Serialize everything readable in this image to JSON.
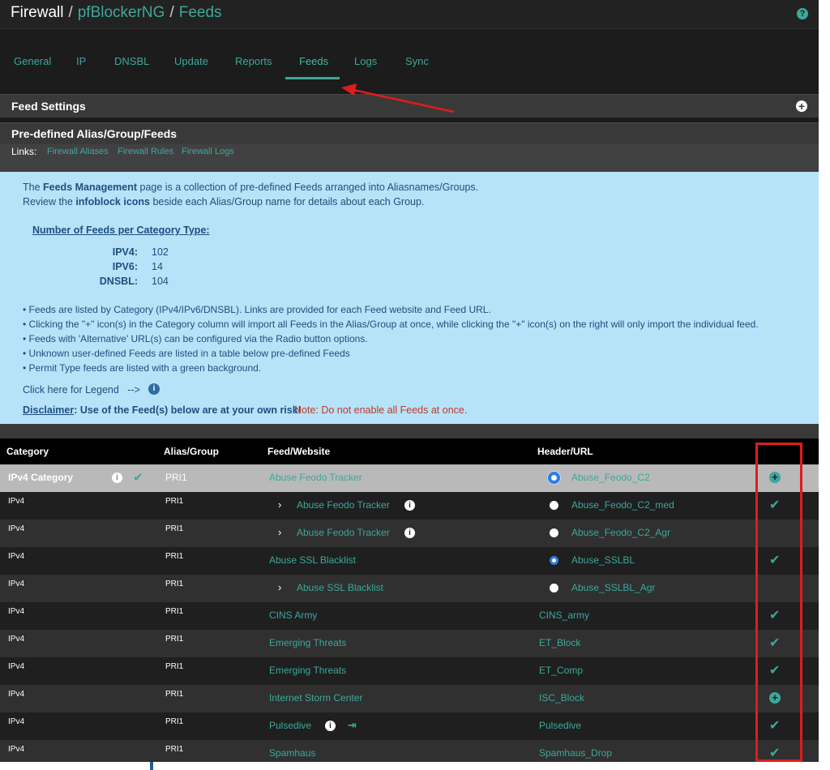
{
  "breadcrumb": {
    "root": "Firewall",
    "sep": "/",
    "items": [
      "pfBlockerNG",
      "Feeds"
    ]
  },
  "help_icon": "?",
  "tabs": [
    {
      "label": "General",
      "active": false
    },
    {
      "label": "IP",
      "active": false
    },
    {
      "label": "DNSBL",
      "active": false
    },
    {
      "label": "Update",
      "active": false
    },
    {
      "label": "Reports",
      "active": false
    },
    {
      "label": "Feeds",
      "active": true
    },
    {
      "label": "Logs",
      "active": false
    },
    {
      "label": "Sync",
      "active": false
    }
  ],
  "feed_settings": {
    "title": "Feed Settings",
    "toggle": "+"
  },
  "predefined": {
    "title": "Pre-defined Alias/Group/Feeds",
    "links_label": "Links:",
    "links": [
      "Firewall Aliases",
      "Firewall Rules",
      "Firewall Logs"
    ]
  },
  "info": {
    "line1_a": "The ",
    "line1_b": "Feeds Management",
    "line1_c": " page is a collection of pre-defined Feeds arranged into Aliasnames/Groups.",
    "line2_a": "Review the ",
    "line2_b": "infoblock icons",
    "line2_c": " beside each Alias/Group name for details about each Group.",
    "count_title": "Number of Feeds per Category Type:",
    "counts": [
      {
        "key": "IPV4:",
        "value": "102"
      },
      {
        "key": "IPV6:",
        "value": "14"
      },
      {
        "key": "DNSBL:",
        "value": "104"
      }
    ],
    "bullets": [
      "• Feeds are listed by Category (IPv4/IPv6/DNSBL). Links are provided for each Feed website and Feed URL.",
      "• Clicking the \"+\" icon(s) in the Category column will import all Feeds in the Alias/Group at once, while clicking the \"+\" icon(s) on the right will only import the individual feed.",
      "• Feeds with 'Alternative' URL(s) can be configured via the Radio button options.",
      "• Unknown user-defined Feeds are listed in a table below pre-defined Feeds",
      "• Permit Type feeds are listed with a green background."
    ],
    "legend_text": "Click here for Legend",
    "legend_arrow": "-->",
    "info_glyph": "i",
    "disclaimer_label": "Disclaimer",
    "disclaimer_text": ": Use of the Feed(s) below are at your own risk!",
    "note": "Note: Do not enable all Feeds at once."
  },
  "table": {
    "headers": [
      "Category",
      "Alias/Group",
      "Feed/Website",
      "Header/URL"
    ],
    "category_row": {
      "category": "IPv4 Category",
      "alias": "PRI1",
      "feed": "Abuse Feodo Tracker",
      "header": "Abuse_Feodo_C2",
      "radio": "on",
      "action": "add"
    },
    "rows": [
      {
        "category": "IPv4",
        "alias": "PRI1",
        "feed": "Abuse Feodo Tracker",
        "sub": true,
        "info": true,
        "header": "Abuse_Feodo_C2_med",
        "radio": "off",
        "action": "check"
      },
      {
        "category": "IPv4",
        "alias": "PRI1",
        "feed": "Abuse Feodo Tracker",
        "sub": true,
        "info": true,
        "header": "Abuse_Feodo_C2_Agr",
        "radio": "off",
        "action": ""
      },
      {
        "category": "IPv4",
        "alias": "PRI1",
        "feed": "Abuse SSL Blacklist",
        "sub": false,
        "info": false,
        "header": "Abuse_SSLBL",
        "radio": "on",
        "action": "check"
      },
      {
        "category": "IPv4",
        "alias": "PRI1",
        "feed": "Abuse SSL Blacklist",
        "sub": true,
        "info": false,
        "header": "Abuse_SSLBL_Agr",
        "radio": "off",
        "action": ""
      },
      {
        "category": "IPv4",
        "alias": "PRI1",
        "feed": "CINS Army",
        "sub": false,
        "info": false,
        "header": "CINS_army",
        "radio": "none",
        "action": "check"
      },
      {
        "category": "IPv4",
        "alias": "PRI1",
        "feed": "Emerging Threats",
        "sub": false,
        "info": false,
        "header": "ET_Block",
        "radio": "none",
        "action": "check"
      },
      {
        "category": "IPv4",
        "alias": "PRI1",
        "feed": "Emerging Threats",
        "sub": false,
        "info": false,
        "header": "ET_Comp",
        "radio": "none",
        "action": "check"
      },
      {
        "category": "IPv4",
        "alias": "PRI1",
        "feed": "Internet Storm Center",
        "sub": false,
        "info": false,
        "header": "ISC_Block",
        "radio": "none",
        "action": "add"
      },
      {
        "category": "IPv4",
        "alias": "PRI1",
        "feed": "Pulsedive",
        "sub": false,
        "info": true,
        "signin": true,
        "header": "Pulsedive",
        "radio": "none",
        "action": "check"
      },
      {
        "category": "IPv4",
        "alias": "PRI1",
        "feed": "Spamhaus",
        "sub": false,
        "info": false,
        "header": "Spamhaus_Drop",
        "radio": "none",
        "action": "check"
      }
    ]
  },
  "glyphs": {
    "check": "✔",
    "plus": "+",
    "chevron": "›",
    "signin": "⇥",
    "info": "i"
  },
  "colors": {
    "accent": "#3ca89c",
    "info_bg": "#b6e3f7",
    "highlight_box": "#e01c1c",
    "radio_blue": "#2f7be8"
  }
}
